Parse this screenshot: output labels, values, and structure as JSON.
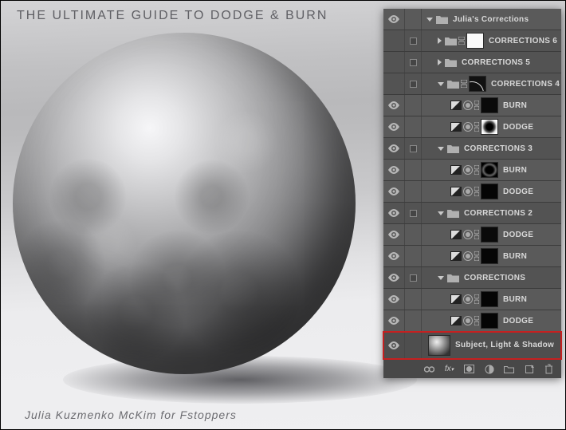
{
  "header": {
    "title": "THE ULTIMATE GUIDE TO DODGE & BURN",
    "credit": "Julia Kuzmenko McKim for Fstoppers"
  },
  "layers": {
    "root": "Julia's Corrections",
    "g6": "CORRECTIONS 6",
    "g5": "CORRECTIONS 5",
    "g4": "CORRECTIONS 4",
    "g4_burn": "BURN",
    "g4_dodge": "DODGE",
    "g3": "CORRECTIONS 3",
    "g3_burn": "BURN",
    "g3_dodge": "DODGE",
    "g2": "CORRECTIONS 2",
    "g2_dodge": "DODGE",
    "g2_burn": "BURN",
    "g1": "CORRECTIONS",
    "g1_burn": "BURN",
    "g1_dodge": "DODGE",
    "subject": "Subject, Light & Shadow"
  },
  "footer": {
    "link": "⇔",
    "fx": "fx.",
    "mask_btn": "mask",
    "adj_btn": "adj",
    "group_btn": "group",
    "new_btn": "new",
    "trash": "trash"
  }
}
